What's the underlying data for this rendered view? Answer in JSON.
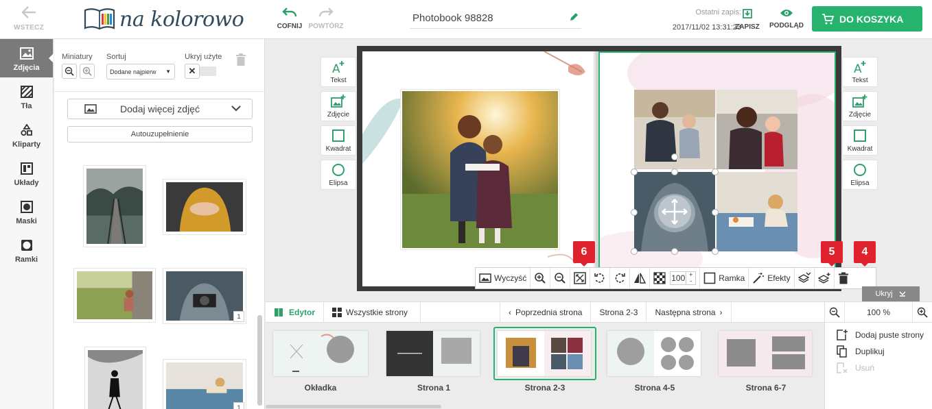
{
  "topbar": {
    "back_label": "WSTECZ",
    "logo_text": "na kolorowo",
    "undo_label": "COFNIJ",
    "redo_label": "POWTÓRZ",
    "project_title": "Photobook 98828",
    "last_save_label": "Ostatni zapis:",
    "last_save_time": "2017/11/02 13:31:23",
    "save_label": "ZAPISZ",
    "preview_label": "PODGLĄD",
    "cart_label": "DO KOSZYKA"
  },
  "leftnav": {
    "items": [
      {
        "label": "Zdjęcia",
        "icon": "image-icon",
        "active": true
      },
      {
        "label": "Tła",
        "icon": "pattern-icon",
        "active": false
      },
      {
        "label": "Kliparty",
        "icon": "shapes-icon",
        "active": false
      },
      {
        "label": "Układy",
        "icon": "layout-icon",
        "active": false
      },
      {
        "label": "Maski",
        "icon": "mask-icon",
        "active": false
      },
      {
        "label": "Ramki",
        "icon": "frame-icon",
        "active": false
      }
    ]
  },
  "panel": {
    "thumbs_label": "Miniatury",
    "sort_label": "Sortuj",
    "sort_value": "Dodane najpierw",
    "hide_used_label": "Ukryj użyte",
    "add_more_label": "Dodaj więcej zdjęć",
    "autofill_label": "Autouzupełnienie",
    "photos": [
      {
        "badge": ""
      },
      {
        "badge": ""
      },
      {
        "badge": ""
      },
      {
        "badge": "1"
      },
      {
        "badge": ""
      },
      {
        "badge": "1"
      }
    ]
  },
  "tools_left": [
    {
      "label": "Tekst",
      "icon": "text-add-icon"
    },
    {
      "label": "Zdjęcie",
      "icon": "image-add-icon"
    },
    {
      "label": "Kwadrat",
      "icon": "square-icon"
    },
    {
      "label": "Elipsa",
      "icon": "circle-icon"
    }
  ],
  "tools_right": [
    {
      "label": "Tekst",
      "icon": "text-add-icon"
    },
    {
      "label": "Zdjęcie",
      "icon": "image-add-icon"
    },
    {
      "label": "Kwadrat",
      "icon": "square-icon"
    },
    {
      "label": "Elipsa",
      "icon": "circle-icon"
    }
  ],
  "callouts": {
    "six": "6",
    "five": "5",
    "four": "4"
  },
  "photo_toolbar": {
    "clear_label": "Wyczyść",
    "opacity_value": "100",
    "frame_label": "Ramka",
    "effects_label": "Efekty",
    "plus": "+",
    "minus": "-"
  },
  "hide_label": "Ukryj",
  "pagebar": {
    "editor_label": "Edytor",
    "all_pages_label": "Wszystkie strony",
    "prev_label": "Poprzednia strona",
    "current_label": "Strona 2-3",
    "next_label": "Następna strona",
    "zoom_value": "100 %"
  },
  "pages": [
    {
      "label": "Okładka"
    },
    {
      "label": "Strona 1"
    },
    {
      "label": "Strona 2-3"
    },
    {
      "label": "Strona 4-5"
    },
    {
      "label": "Strona 6-7"
    }
  ],
  "side_actions": {
    "add_blank_label": "Dodaj puste strony",
    "duplicate_label": "Duplikuj",
    "delete_label": "Usuń"
  },
  "colors": {
    "accent": "#26b36e",
    "callout": "#e0212e"
  }
}
